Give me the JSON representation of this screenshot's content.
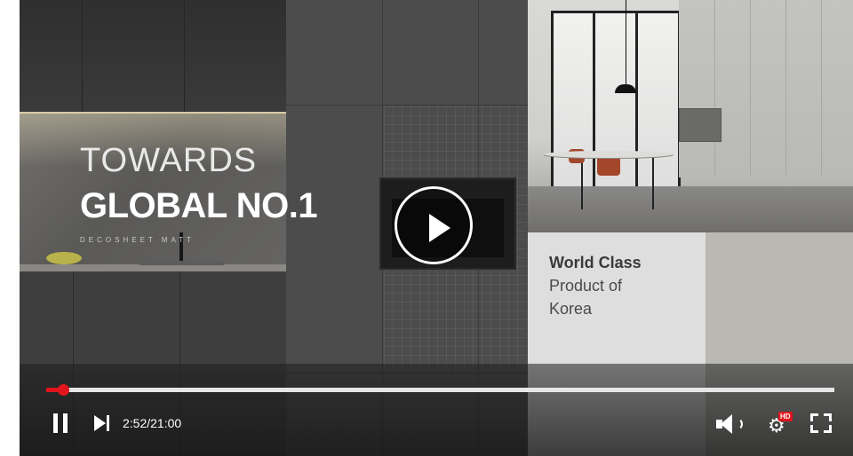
{
  "video": {
    "headline_line1": "TOWARDS",
    "headline_line2": "GLOBAL NO.1",
    "brand_line": "DECOSHEET MATT",
    "caption_strong": "World Class",
    "caption_line2": "Product of",
    "caption_line3": "Korea"
  },
  "player": {
    "time_display": "2:52/21:00",
    "current_time": "2:52",
    "duration": "21:00",
    "progress_fraction": 0.0219,
    "hd_badge": "HD",
    "state": "paused",
    "icons": {
      "big_play": "play-icon",
      "pause": "pause-icon",
      "next": "next-icon",
      "volume": "volume-icon",
      "settings": "gear-icon",
      "fullscreen": "fullscreen-icon"
    },
    "colors": {
      "accent": "#e0161c",
      "track": "#e6e6e6",
      "icon": "#ffffff"
    }
  }
}
